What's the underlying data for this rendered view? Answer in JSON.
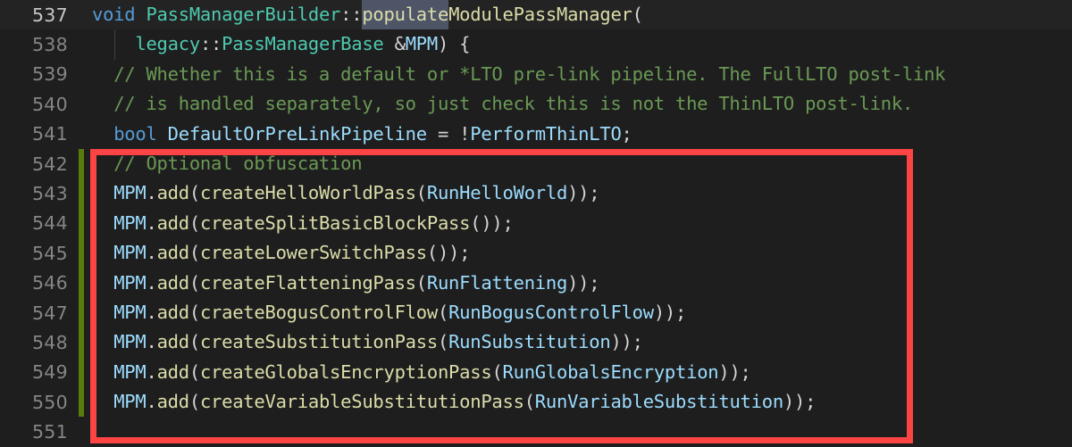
{
  "editor": {
    "theme_colors": {
      "background": "#1e1e1e",
      "active_line_background": "#232323",
      "line_number": "#858585",
      "active_line_number": "#c6c6c6",
      "keyword": "#569cd6",
      "type": "#4ec9b0",
      "function": "#dcdcaa",
      "variable": "#9cdcfe",
      "comment": "#6a9955",
      "punctuation": "#d4d4d4",
      "selection": "#4d5567",
      "change_bar_green": "#587c0c",
      "annotation_red": "#fc4444"
    },
    "lines": [
      {
        "number": "537",
        "active": true,
        "changed": false,
        "tokens": [
          {
            "text": "void",
            "cls": "kw"
          },
          {
            "text": " ",
            "cls": "pl"
          },
          {
            "text": "PassManagerBuilder",
            "cls": "type"
          },
          {
            "text": "::",
            "cls": "pl"
          },
          {
            "text": "populate",
            "cls": "fn sel"
          },
          {
            "text": "ModulePassManager",
            "cls": "fn"
          },
          {
            "text": "(",
            "cls": "pl"
          }
        ]
      },
      {
        "number": "538",
        "active": false,
        "changed": false,
        "indent_guide": true,
        "tokens": [
          {
            "text": "    ",
            "cls": "pl"
          },
          {
            "text": "legacy",
            "cls": "type"
          },
          {
            "text": "::",
            "cls": "pl"
          },
          {
            "text": "PassManagerBase",
            "cls": "type"
          },
          {
            "text": " ",
            "cls": "pl"
          },
          {
            "text": "&",
            "cls": "pl"
          },
          {
            "text": "MPM",
            "cls": "var"
          },
          {
            "text": ") {",
            "cls": "pl"
          }
        ]
      },
      {
        "number": "539",
        "active": false,
        "changed": false,
        "tokens": [
          {
            "text": "  ",
            "cls": "pl"
          },
          {
            "text": "// Whether this is a default or *LTO pre-link pipeline. The FullLTO post-link",
            "cls": "cmt"
          }
        ]
      },
      {
        "number": "540",
        "active": false,
        "changed": false,
        "tokens": [
          {
            "text": "  ",
            "cls": "pl"
          },
          {
            "text": "// is handled separately, so just check this is not the ThinLTO post-link.",
            "cls": "cmt"
          }
        ]
      },
      {
        "number": "541",
        "active": false,
        "changed": false,
        "tokens": [
          {
            "text": "  ",
            "cls": "pl"
          },
          {
            "text": "bool",
            "cls": "kw"
          },
          {
            "text": " ",
            "cls": "pl"
          },
          {
            "text": "DefaultOrPreLinkPipeline",
            "cls": "var"
          },
          {
            "text": " = ",
            "cls": "pl"
          },
          {
            "text": "!",
            "cls": "pl"
          },
          {
            "text": "PerformThinLTO",
            "cls": "var"
          },
          {
            "text": ";",
            "cls": "pl"
          }
        ]
      },
      {
        "number": "542",
        "active": false,
        "changed": true,
        "tokens": [
          {
            "text": "  ",
            "cls": "pl"
          },
          {
            "text": "// Optional obfuscation",
            "cls": "cmt"
          }
        ]
      },
      {
        "number": "543",
        "active": false,
        "changed": true,
        "tokens": [
          {
            "text": "  ",
            "cls": "pl"
          },
          {
            "text": "MPM",
            "cls": "var"
          },
          {
            "text": ".",
            "cls": "pl"
          },
          {
            "text": "add",
            "cls": "fn"
          },
          {
            "text": "(",
            "cls": "pl"
          },
          {
            "text": "createHelloWorldPass",
            "cls": "fn"
          },
          {
            "text": "(",
            "cls": "pl"
          },
          {
            "text": "RunHelloWorld",
            "cls": "var"
          },
          {
            "text": "));",
            "cls": "pl"
          }
        ]
      },
      {
        "number": "544",
        "active": false,
        "changed": true,
        "tokens": [
          {
            "text": "  ",
            "cls": "pl"
          },
          {
            "text": "MPM",
            "cls": "var"
          },
          {
            "text": ".",
            "cls": "pl"
          },
          {
            "text": "add",
            "cls": "fn"
          },
          {
            "text": "(",
            "cls": "pl"
          },
          {
            "text": "createSplitBasicBlockPass",
            "cls": "fn"
          },
          {
            "text": "());",
            "cls": "pl"
          }
        ]
      },
      {
        "number": "545",
        "active": false,
        "changed": true,
        "tokens": [
          {
            "text": "  ",
            "cls": "pl"
          },
          {
            "text": "MPM",
            "cls": "var"
          },
          {
            "text": ".",
            "cls": "pl"
          },
          {
            "text": "add",
            "cls": "fn"
          },
          {
            "text": "(",
            "cls": "pl"
          },
          {
            "text": "createLowerSwitchPass",
            "cls": "fn"
          },
          {
            "text": "());",
            "cls": "pl"
          }
        ]
      },
      {
        "number": "546",
        "active": false,
        "changed": true,
        "tokens": [
          {
            "text": "  ",
            "cls": "pl"
          },
          {
            "text": "MPM",
            "cls": "var"
          },
          {
            "text": ".",
            "cls": "pl"
          },
          {
            "text": "add",
            "cls": "fn"
          },
          {
            "text": "(",
            "cls": "pl"
          },
          {
            "text": "createFlatteningPass",
            "cls": "fn"
          },
          {
            "text": "(",
            "cls": "pl"
          },
          {
            "text": "RunFlattening",
            "cls": "var"
          },
          {
            "text": "));",
            "cls": "pl"
          }
        ]
      },
      {
        "number": "547",
        "active": false,
        "changed": true,
        "tokens": [
          {
            "text": "  ",
            "cls": "pl"
          },
          {
            "text": "MPM",
            "cls": "var"
          },
          {
            "text": ".",
            "cls": "pl"
          },
          {
            "text": "add",
            "cls": "fn"
          },
          {
            "text": "(",
            "cls": "pl"
          },
          {
            "text": "craeteBogusControlFlow",
            "cls": "fn"
          },
          {
            "text": "(",
            "cls": "pl"
          },
          {
            "text": "RunBogusControlFlow",
            "cls": "var"
          },
          {
            "text": "));",
            "cls": "pl"
          }
        ]
      },
      {
        "number": "548",
        "active": false,
        "changed": true,
        "tokens": [
          {
            "text": "  ",
            "cls": "pl"
          },
          {
            "text": "MPM",
            "cls": "var"
          },
          {
            "text": ".",
            "cls": "pl"
          },
          {
            "text": "add",
            "cls": "fn"
          },
          {
            "text": "(",
            "cls": "pl"
          },
          {
            "text": "createSubstitutionPass",
            "cls": "fn"
          },
          {
            "text": "(",
            "cls": "pl"
          },
          {
            "text": "RunSubstitution",
            "cls": "var"
          },
          {
            "text": "));",
            "cls": "pl"
          }
        ]
      },
      {
        "number": "549",
        "active": false,
        "changed": true,
        "tokens": [
          {
            "text": "  ",
            "cls": "pl"
          },
          {
            "text": "MPM",
            "cls": "var"
          },
          {
            "text": ".",
            "cls": "pl"
          },
          {
            "text": "add",
            "cls": "fn"
          },
          {
            "text": "(",
            "cls": "pl"
          },
          {
            "text": "createGlobalsEncryptionPass",
            "cls": "fn"
          },
          {
            "text": "(",
            "cls": "pl"
          },
          {
            "text": "RunGlobalsEncryption",
            "cls": "var"
          },
          {
            "text": "));",
            "cls": "pl"
          }
        ]
      },
      {
        "number": "550",
        "active": false,
        "changed": true,
        "tokens": [
          {
            "text": "  ",
            "cls": "pl"
          },
          {
            "text": "MPM",
            "cls": "var"
          },
          {
            "text": ".",
            "cls": "pl"
          },
          {
            "text": "add",
            "cls": "fn"
          },
          {
            "text": "(",
            "cls": "pl"
          },
          {
            "text": "createVariableSubstitutionPass",
            "cls": "fn"
          },
          {
            "text": "(",
            "cls": "pl"
          },
          {
            "text": "RunVariableSubstitution",
            "cls": "var"
          },
          {
            "text": "));",
            "cls": "pl"
          }
        ]
      },
      {
        "number": "551",
        "active": false,
        "changed": false,
        "tokens": []
      }
    ]
  }
}
